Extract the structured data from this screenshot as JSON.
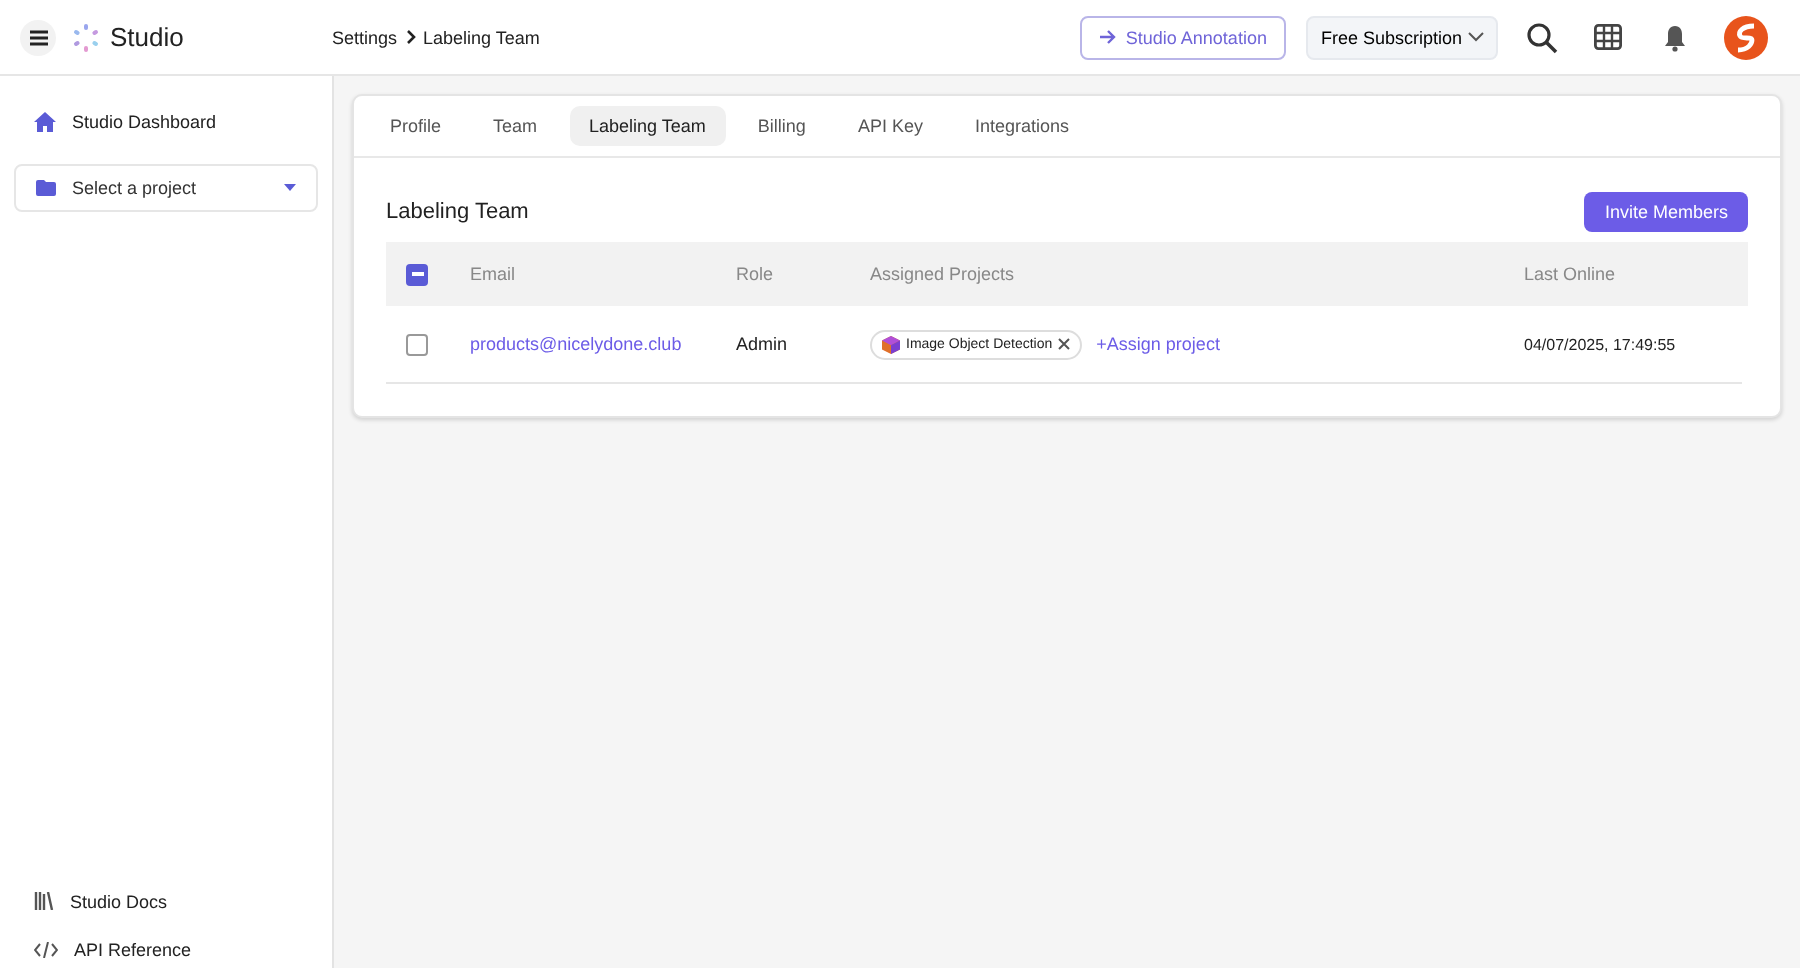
{
  "header": {
    "app_name": "Studio",
    "breadcrumb": [
      "Settings",
      "Labeling Team"
    ],
    "annotation_button": "Studio Annotation",
    "subscription": "Free Subscription"
  },
  "sidebar": {
    "items": [
      {
        "label": "Studio Dashboard",
        "kind": "home"
      }
    ],
    "project_select": {
      "placeholder": "Select a project"
    },
    "footer_items": [
      {
        "label": "Studio Docs",
        "kind": "docs"
      },
      {
        "label": "API Reference",
        "kind": "code"
      }
    ]
  },
  "tabs": [
    {
      "label": "Profile",
      "selected": false
    },
    {
      "label": "Team",
      "selected": false
    },
    {
      "label": "Labeling Team",
      "selected": true
    },
    {
      "label": "Billing",
      "selected": false
    },
    {
      "label": "API Key",
      "selected": false
    },
    {
      "label": "Integrations",
      "selected": false
    }
  ],
  "section": {
    "title": "Labeling Team",
    "invite_button": "Invite Members"
  },
  "table": {
    "select_all_indeterminate": true,
    "columns": [
      "Email",
      "Role",
      "Assigned Projects",
      "Last Online"
    ],
    "rows": [
      {
        "checked": false,
        "email": "products@nicelydone.club",
        "role": "Admin",
        "projects": [
          "Image Object Detection"
        ],
        "assign_link": "+Assign project",
        "last_online": "04/07/2025, 17:49:55"
      }
    ]
  }
}
